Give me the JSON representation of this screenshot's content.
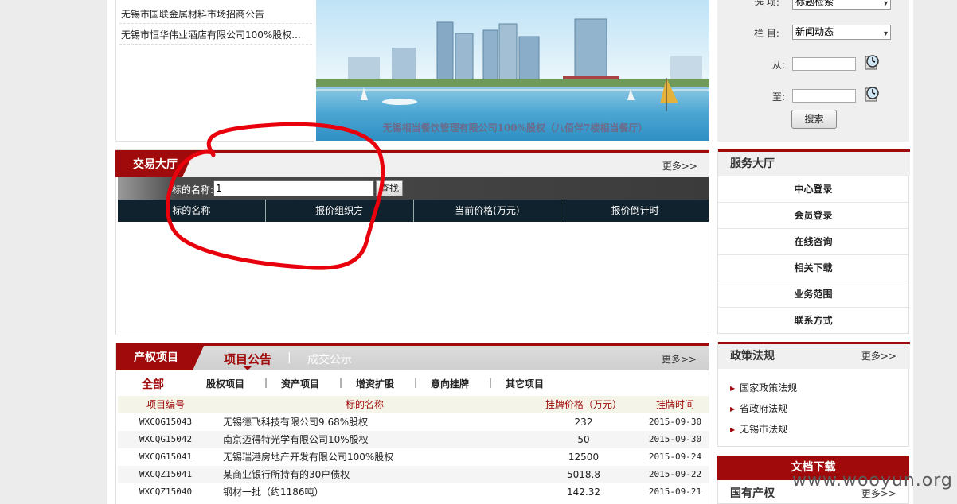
{
  "news_list": [
    "无锡市国联金属材料市场招商公告",
    "无锡市恒华伟业酒店有限公司100%股权..."
  ],
  "banner": {
    "caption": "无锡相当餐饮管理有限公司100%股权（八佰伴7楼相当餐厅）"
  },
  "search_panel": {
    "option_label": "选  项:",
    "option_value": "标题检索",
    "column_label": "栏  目:",
    "column_value": "新闻动态",
    "from_label": "从:",
    "to_label": "至:",
    "search_button": "搜索"
  },
  "trading_hall": {
    "title": "交易大厅",
    "more": "更多>>",
    "name_label": "标的名称:",
    "name_value": "1",
    "find_button": "查找",
    "columns": [
      "标的名称",
      "报价组织方",
      "当前价格(万元)",
      "报价倒计时"
    ]
  },
  "projects": {
    "tab_main": "产权项目",
    "tab_notice": "项目公告",
    "separator": "|",
    "tab_done": "成交公示",
    "more": "更多>>",
    "filters": [
      "全部",
      "股权项目",
      "资产项目",
      "增资扩股",
      "意向挂牌",
      "其它项目"
    ],
    "columns": [
      "项目编号",
      "标的名称",
      "挂牌价格（万元）",
      "挂牌时间"
    ],
    "rows": [
      {
        "id": "WXCQG15043",
        "name": "无锡德飞科技有限公司9.68%股权",
        "price": "232",
        "date": "2015-09-30"
      },
      {
        "id": "WXCQG15042",
        "name": "南京迈得特光学有限公司10%股权",
        "price": "50",
        "date": "2015-09-30"
      },
      {
        "id": "WXCQG15041",
        "name": "无锡瑞港房地产开发有限公司100%股权",
        "price": "12500",
        "date": "2015-09-24"
      },
      {
        "id": "WXCQZ15041",
        "name": "某商业银行所持有的30户债权",
        "price": "5018.8",
        "date": "2015-09-22"
      },
      {
        "id": "WXCQZ15040",
        "name": "钢材一批（约1186吨）",
        "price": "142.32",
        "date": "2015-09-21"
      }
    ]
  },
  "service_hall": {
    "title": "服务大厅",
    "items": [
      "中心登录",
      "会员登录",
      "在线咨询",
      "相关下载",
      "业务范围",
      "联系方式"
    ]
  },
  "policy": {
    "title": "政策法规",
    "more": "更多>>",
    "items": [
      "国家政策法规",
      "省政府法规",
      "无锡市法规"
    ]
  },
  "docs": {
    "title": "文档下载"
  },
  "state_property": {
    "title": "国有产权",
    "more": "更多>>"
  },
  "watermark": "www.wooyun.org",
  "colors": {
    "brand_red": "#a00a0a",
    "table_header": "#10222e",
    "annotation_red": "#e8000c"
  },
  "icons": [
    "calendar-clock-icon",
    "dropdown-arrow-icon",
    "triangle-bullet-icon"
  ]
}
